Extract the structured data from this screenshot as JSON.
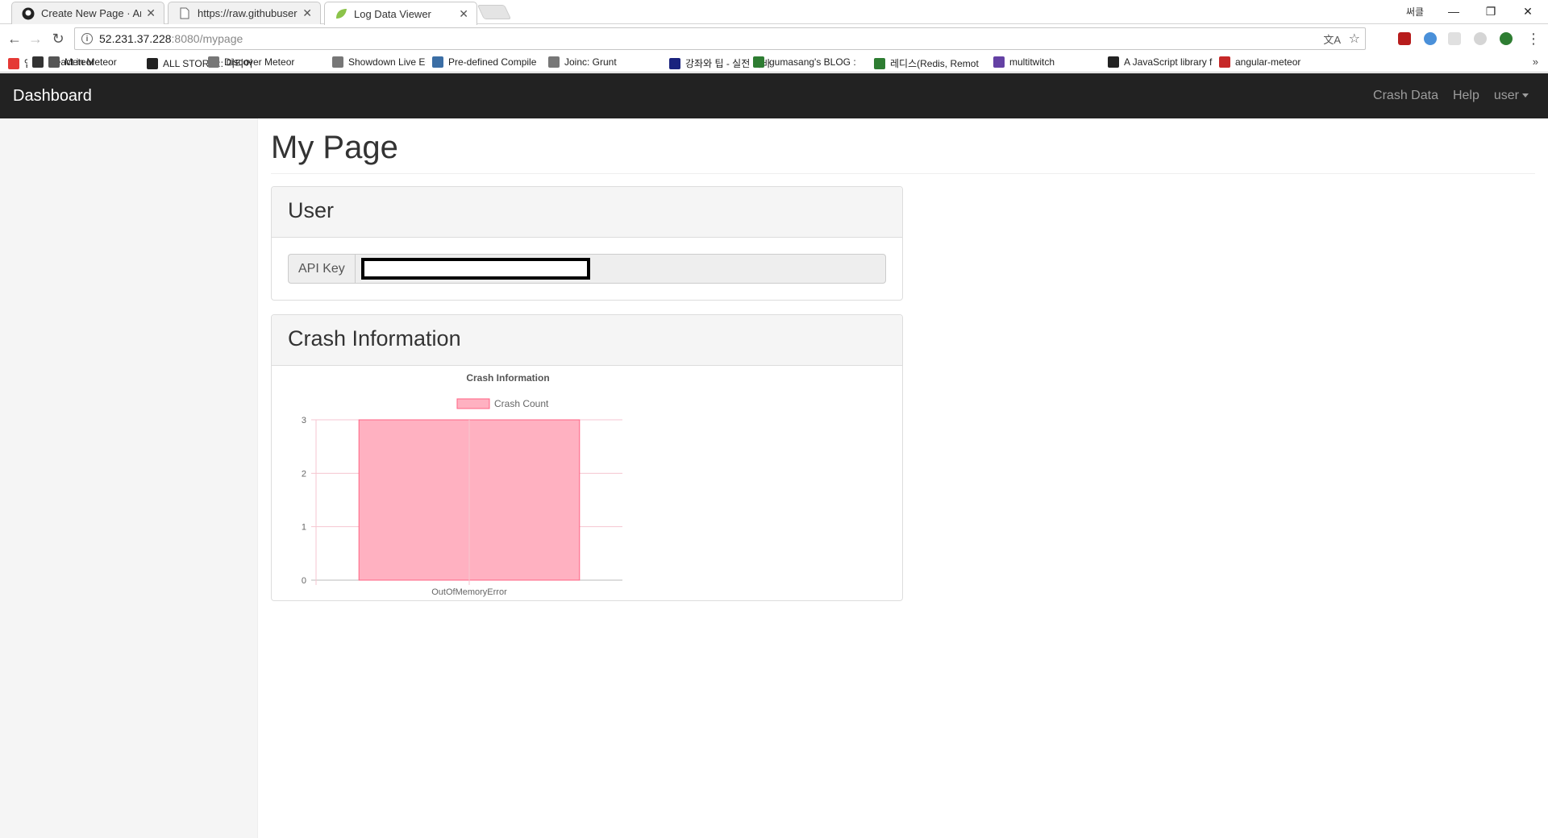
{
  "browser": {
    "tabs": [
      {
        "title": "Create New Page · Andi",
        "icon": "github-icon"
      },
      {
        "title": "https://raw.githubuserco",
        "icon": "document-icon"
      },
      {
        "title": "Log Data Viewer",
        "icon": "leaf-icon"
      }
    ],
    "profile_label": "써클",
    "url_host": "52.231.37.228",
    "url_path": ":8080/mypage",
    "bookmarks": [
      {
        "label": "앱",
        "color": "#e53935"
      },
      {
        "label": "React in Meteor",
        "color": "#333333"
      },
      {
        "label": "Meteor",
        "color": "#555555"
      },
      {
        "label": "ALL STORY :: 미티어",
        "color": "#222222"
      },
      {
        "label": "Discover Meteor",
        "color": "#777777"
      },
      {
        "label": "Showdown Live Edito",
        "color": "#777777"
      },
      {
        "label": "Pre-defined Compile",
        "color": "#3b6ea5"
      },
      {
        "label": "Joinc: Grunt",
        "color": "#777777"
      },
      {
        "label": "강좌와 팁 - 실전 자바",
        "color": "#1a237e"
      },
      {
        "label": "gumasang's BLOG :",
        "color": "#2e7d32"
      },
      {
        "label": "레디스(Redis, Remot",
        "color": "#2e7d32"
      },
      {
        "label": "multitwitch",
        "color": "#6441a4"
      },
      {
        "label": "A JavaScript library f",
        "color": "#222222"
      },
      {
        "label": "angular-meteor",
        "color": "#c62828"
      }
    ],
    "bookmarks_overflow": "»"
  },
  "app": {
    "brand": "Dashboard",
    "nav": {
      "crash_data": "Crash Data",
      "help": "Help",
      "user": "user"
    },
    "page_title": "My Page",
    "user_panel": {
      "title": "User",
      "api_key_label": "API Key"
    },
    "crash_panel": {
      "title": "Crash Information"
    }
  },
  "chart_data": {
    "type": "bar",
    "title": "Crash Information",
    "categories": [
      "OutOfMemoryError"
    ],
    "series": [
      {
        "name": "Crash Count",
        "values": [
          3
        ]
      }
    ],
    "ylim": [
      0,
      3
    ],
    "yticks": [
      0,
      1,
      2,
      3
    ],
    "grid": true,
    "legend": "top",
    "colors": {
      "fill": "#ffb1c1",
      "border": "#ff6384",
      "grid": "#f5c6d0",
      "axis": "#bbbbbb"
    }
  }
}
